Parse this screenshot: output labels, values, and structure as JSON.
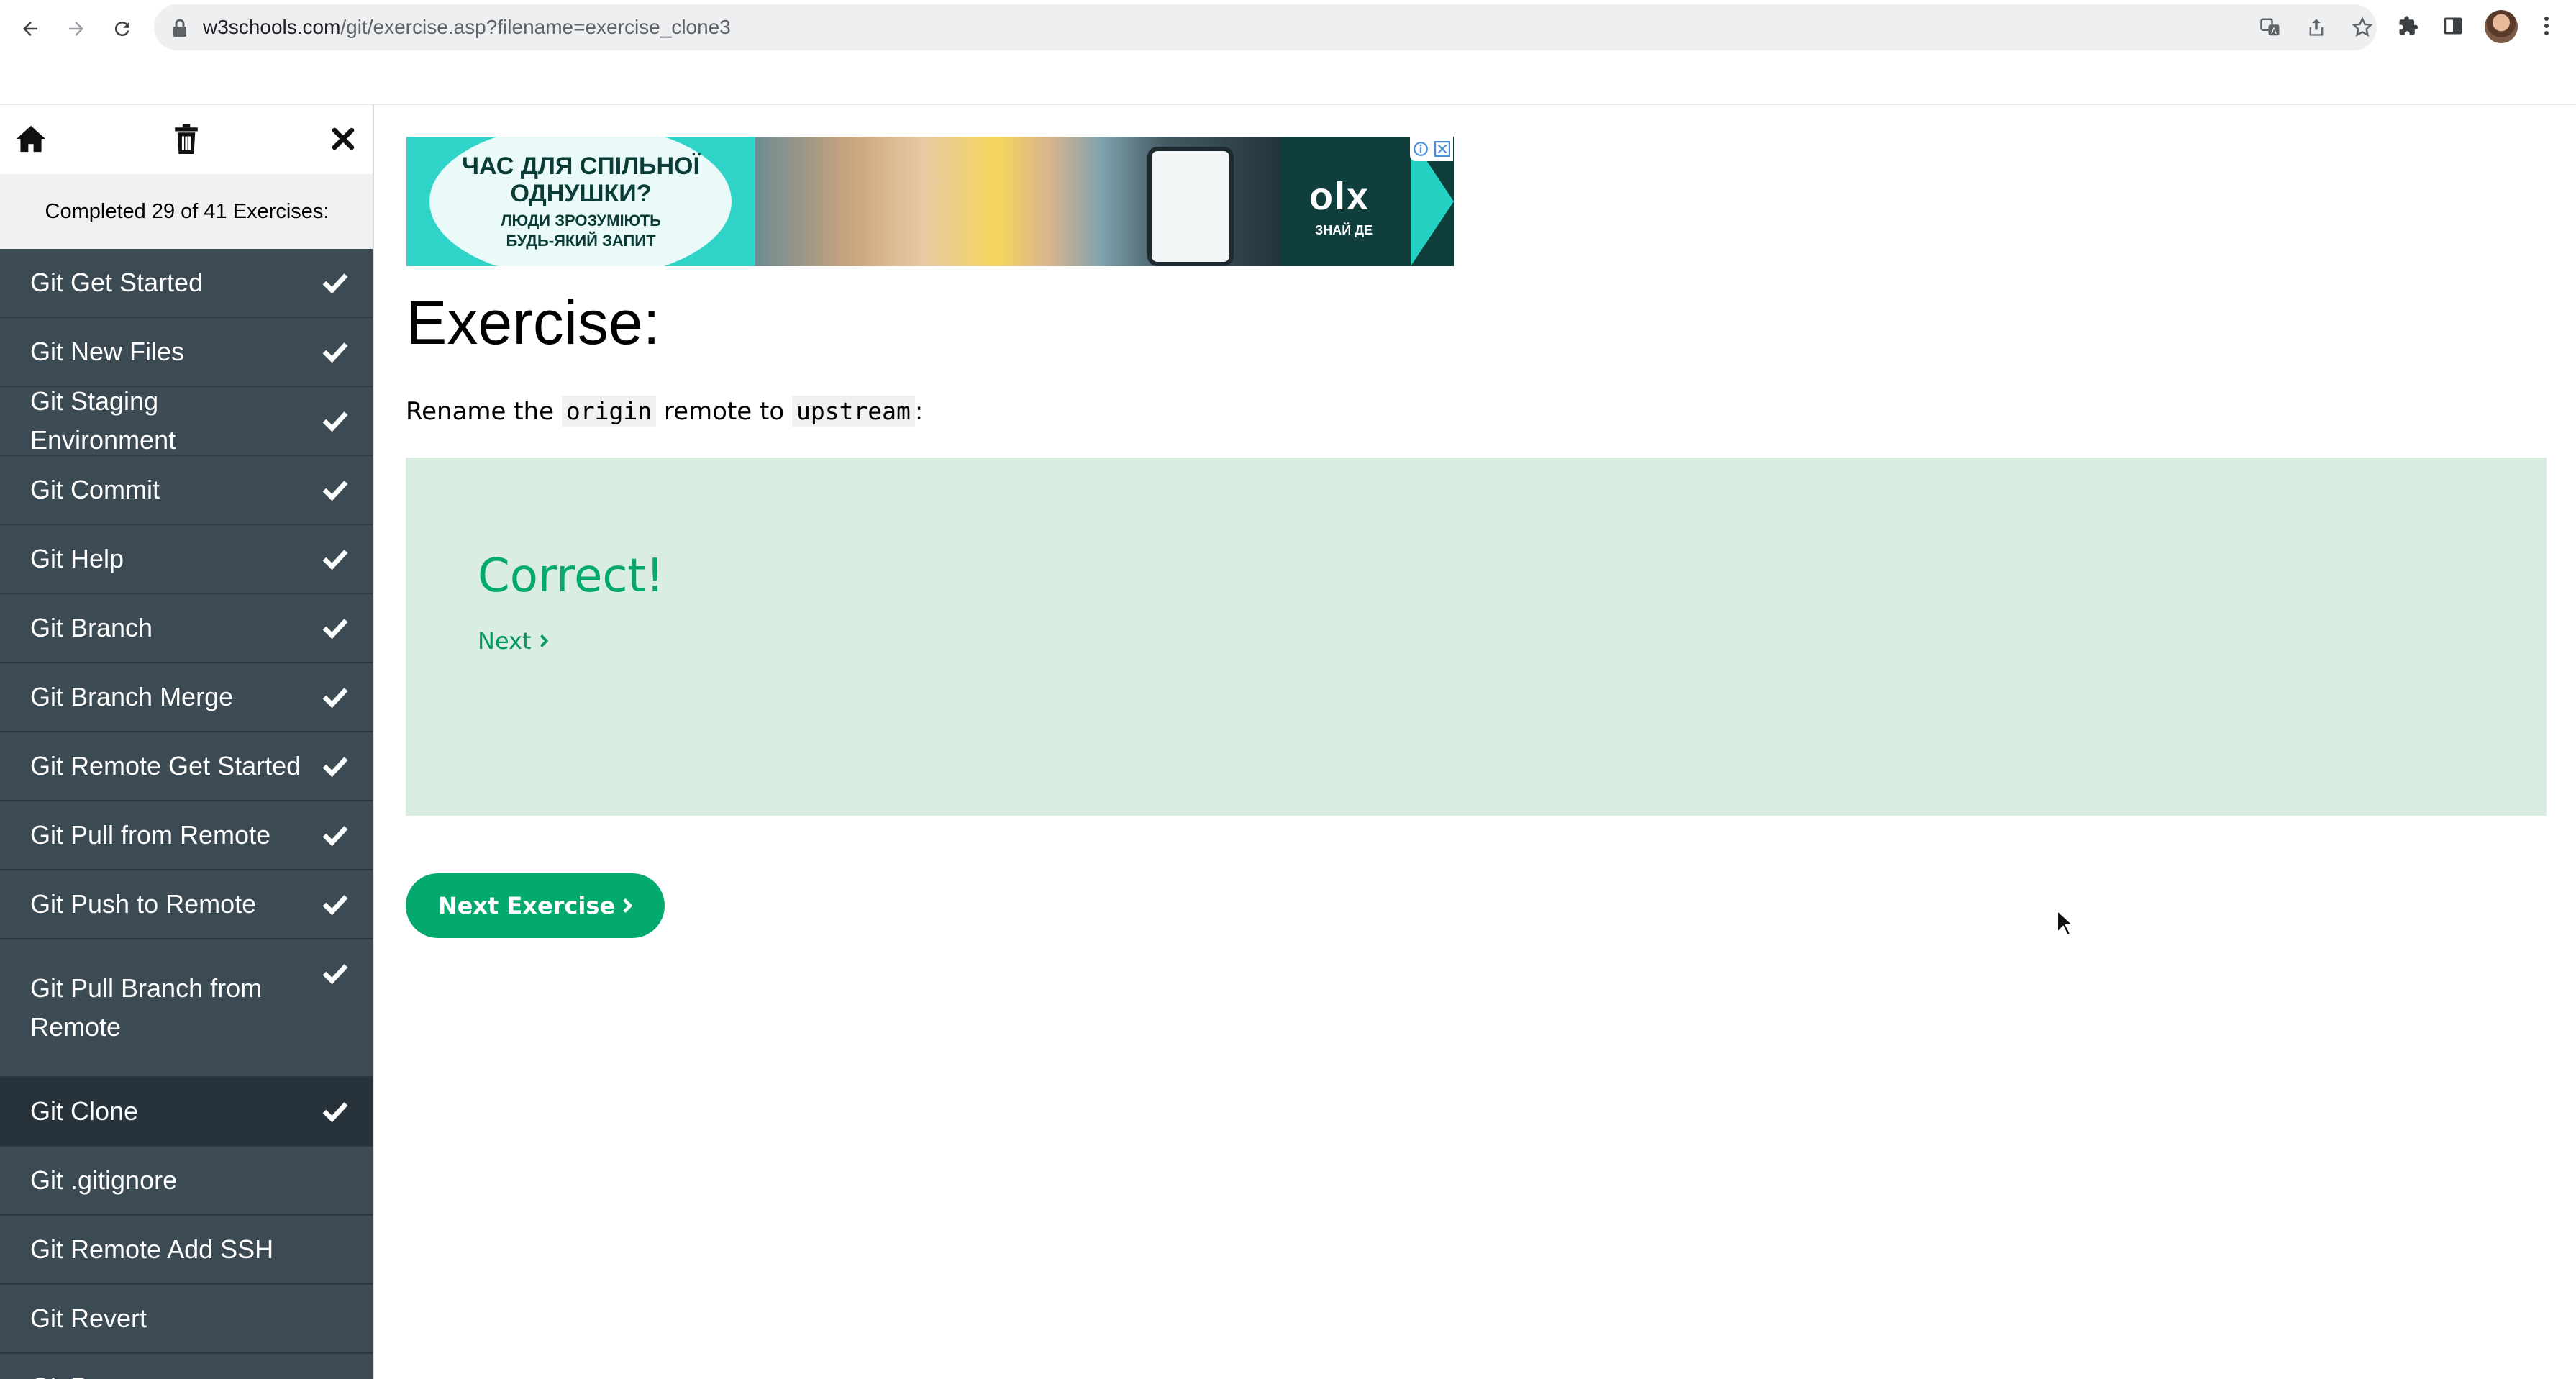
{
  "browser": {
    "url_host": "w3schools.com",
    "url_path": "/git/exercise.asp?filename=exercise_clone3",
    "icons": [
      "back-arrow-icon",
      "forward-arrow-icon",
      "reload-icon",
      "lock-icon",
      "translate-icon",
      "share-icon",
      "star-icon",
      "puzzle-icon",
      "side-panel-icon",
      "profile-avatar",
      "more-vert-icon"
    ]
  },
  "sidebar": {
    "tools": [
      "home-icon",
      "trash-icon",
      "close-icon"
    ],
    "progress_text": "Completed 29 of 41 Exercises:",
    "items": [
      {
        "label": "Git Get Started",
        "done": true
      },
      {
        "label": "Git New Files",
        "done": true
      },
      {
        "label": "Git Staging Environment",
        "done": true
      },
      {
        "label": "Git Commit",
        "done": true
      },
      {
        "label": "Git Help",
        "done": true
      },
      {
        "label": "Git Branch",
        "done": true
      },
      {
        "label": "Git Branch Merge",
        "done": true
      },
      {
        "label": "Git Remote Get Started",
        "done": true
      },
      {
        "label": "Git Pull from Remote",
        "done": true
      },
      {
        "label": "Git Push to Remote",
        "done": true
      },
      {
        "label": "Git Pull Branch from Remote",
        "done": true
      },
      {
        "label": "Git Clone",
        "done": true,
        "active": true
      },
      {
        "label": "Git .gitignore",
        "done": false
      },
      {
        "label": "Git Remote Add SSH",
        "done": false
      },
      {
        "label": "Git Revert",
        "done": false
      },
      {
        "label": "Git Reset",
        "done": false
      }
    ]
  },
  "ad": {
    "headline_1": "ЧАС ДЛЯ СПІЛЬНОЇ",
    "headline_2": "ОДНУШКИ?",
    "sub_1": "ЛЮДИ ЗРОЗУМІЮТЬ",
    "sub_2": "БУДЬ-ЯКИЙ ЗАПИТ",
    "brand": "olx",
    "brand_sub": "ЗНАЙ ДЕ"
  },
  "exercise": {
    "title": "Exercise:",
    "instruction_prefix": "Rename the ",
    "code_1": "origin",
    "instruction_mid_1": " remote to ",
    "code_2": "upstream",
    "instruction_suffix": ":",
    "result_text": "Correct!",
    "next_link": "Next",
    "next_exercise_button": "Next Exercise"
  },
  "colors": {
    "w3_green": "#04aa6d",
    "sidebar_bg": "#3c4a53",
    "result_bg": "#d9eee1"
  }
}
